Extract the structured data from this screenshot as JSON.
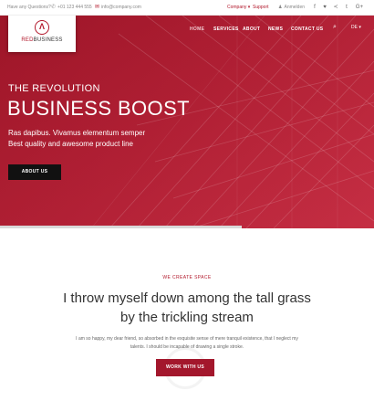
{
  "topbar": {
    "question": "Have any Questions?",
    "phone": "+01 123 444 555",
    "phone_icon": "phone-icon",
    "email": "info@company.com",
    "email_icon": "envelope-icon",
    "company": "Company",
    "company_caret": "▾",
    "support": "Support",
    "login": "Anmelden",
    "login_icon": "user-icon",
    "social": [
      {
        "icon": "facebook-icon",
        "glyph": "f"
      },
      {
        "icon": "twitter-icon",
        "glyph": "♥"
      },
      {
        "icon": "share-icon",
        "glyph": "≺"
      },
      {
        "icon": "tumblr-icon",
        "glyph": "t"
      },
      {
        "icon": "google-plus-icon",
        "glyph": "G+"
      }
    ]
  },
  "logo": {
    "mark": "Λ",
    "brand_red": "RED",
    "brand_dark": "BUSINESS"
  },
  "nav": {
    "items": [
      "HOME",
      "SERVICES",
      "ABOUT",
      "NEWS",
      "CONTACT US"
    ],
    "search_glyph": "⌕",
    "language": "DE",
    "language_caret": "▾"
  },
  "hero": {
    "kicker": "THE REVOLUTION",
    "title": "BUSINESS BOOST",
    "line1": "Ras dapibus. Vivamus elementum semper",
    "line2": "Best quality and awesome product line",
    "button": "ABOUT US"
  },
  "content": {
    "kicker": "WE CREATE SPACE",
    "title": "I throw myself down among the tall grass by the trickling stream",
    "body": "I am so happy, my dear friend, so absorbed in the exquisite sense of mere tranquil existence, that I neglect my talents. I should be incapable of drawing a single stroke.",
    "button": "WORK WITH US"
  },
  "colors": {
    "brand": "#b2182b",
    "hero": "#a5182b",
    "dark_button": "#111111"
  }
}
